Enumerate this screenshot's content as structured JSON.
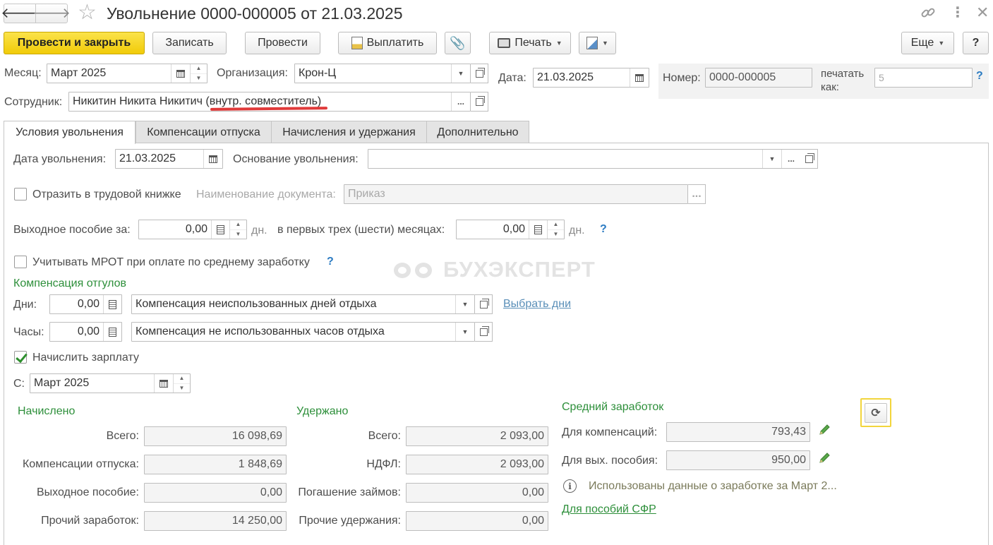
{
  "window": {
    "title": "Увольнение 0000-000005 от 21.03.2025"
  },
  "toolbar": {
    "post_close": "Провести и закрыть",
    "save": "Записать",
    "post": "Провести",
    "pay": "Выплатить",
    "print": "Печать",
    "more": "Еще",
    "help": "?"
  },
  "header": {
    "month_label": "Месяц:",
    "month_value": "Март 2025",
    "org_label": "Организация:",
    "org_value": "Крон-Ц",
    "date_label": "Дата:",
    "date_value": "21.03.2025",
    "number_label": "Номер:",
    "number_value": "0000-000005",
    "print_as_label_1": "печатать",
    "print_as_label_2": "как:",
    "print_as_value": "5",
    "employee_label": "Сотрудник:",
    "employee_value": "Никитин Никита Никитич (внутр. совместитель)"
  },
  "tabs": [
    {
      "label": "Условия увольнения"
    },
    {
      "label": "Компенсации отпуска"
    },
    {
      "label": "Начисления и удержания"
    },
    {
      "label": "Дополнительно"
    }
  ],
  "form": {
    "dismissal_date_label": "Дата увольнения:",
    "dismissal_date_value": "21.03.2025",
    "dismissal_basis_label": "Основание увольнения:",
    "dismissal_basis_value": "",
    "workbook_label": "Отразить в трудовой книжке",
    "doc_name_label": "Наименование документа:",
    "doc_name_value": "Приказ",
    "severance_label": "Выходное пособие за:",
    "severance_value": "0,00",
    "days_unit": "дн.",
    "first_months_label": "в первых трех (шести) месяцах:",
    "first_months_value": "0,00",
    "mrot_label": "Учитывать МРОТ при оплате по среднему заработку",
    "timeoff_heading": "Компенсация отгулов",
    "days_label": "Дни:",
    "days_value": "0,00",
    "days_type": "Компенсация неиспользованных дней отдыха",
    "select_days_link": "Выбрать дни",
    "hours_label": "Часы:",
    "hours_value": "0,00",
    "hours_type": "Компенсация не использованных часов отдыха",
    "salary_label": "Начислить зарплату",
    "salary_checked": true,
    "from_label": "С:",
    "from_value": "Март 2025"
  },
  "accrued": {
    "heading": "Начислено",
    "rows": [
      {
        "label": "Всего:",
        "value": "16 098,69"
      },
      {
        "label": "Компенсации отпуска:",
        "value": "1 848,69"
      },
      {
        "label": "Выходное пособие:",
        "value": "0,00"
      },
      {
        "label": "Прочий заработок:",
        "value": "14 250,00"
      }
    ]
  },
  "withheld": {
    "heading": "Удержано",
    "rows": [
      {
        "label": "Всего:",
        "value": "2 093,00"
      },
      {
        "label": "НДФЛ:",
        "value": "2 093,00"
      },
      {
        "label": "Погашение займов:",
        "value": "0,00"
      },
      {
        "label": "Прочие удержания:",
        "value": "0,00"
      }
    ]
  },
  "average": {
    "heading": "Средний заработок",
    "comp_label": "Для компенсаций:",
    "comp_value": "793,43",
    "sev_label": "Для вых. пособия:",
    "sev_value": "950,00",
    "info_text": "Использованы данные о заработке за Март 2...",
    "sfr_link": "Для пособий СФР"
  },
  "watermark": "БУХЭКСПЕРТ"
}
